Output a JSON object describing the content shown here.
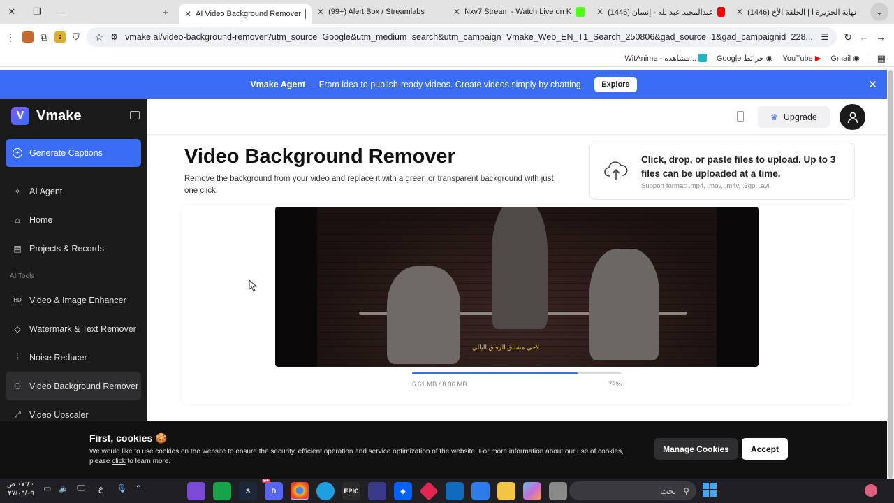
{
  "browser": {
    "tabs": [
      {
        "label": "AI Video Background Remover",
        "active": true,
        "favicon_color": "#5b3fe0"
      },
      {
        "label": "(99+) Alert Box / Streamlabs",
        "active": false,
        "favicon_color": "#16c79a"
      },
      {
        "label": "Nxv7 Stream - Watch Live on K",
        "active": false,
        "favicon_color": "#53fc18"
      },
      {
        "label": "(1446) عبدالمجيد عبدالله - إنسان",
        "active": false,
        "favicon_color": "#ff0000"
      },
      {
        "label": "(1446) نهاية الجزيرة ا | الحلقة الأخ",
        "active": false,
        "favicon_color": "#ff0000"
      }
    ],
    "url": "vmake.ai/video-background-remover?utm_source=Google&utm_medium=search&utm_campaign=Vmake_Web_EN_T1_Search_250806&gad_source=1&gad_campaignid=228...",
    "extension_badge": "2",
    "bookmarks": [
      "WitAnime - مشاهدة...",
      "Google خرائط",
      "YouTube",
      "Gmail"
    ]
  },
  "banner": {
    "brand": "Vmake Agent",
    "text": " — From idea to publish-ready videos. Create videos simply by chatting.",
    "explore_label": "Explore"
  },
  "sidebar": {
    "logo_letter": "V",
    "app_name": "Vmake",
    "primary_button": "Generate Captions",
    "items": [
      {
        "label": "AI Agent",
        "icon": "sparkle-icon"
      },
      {
        "label": "Home",
        "icon": "home-icon"
      },
      {
        "label": "Projects & Records",
        "icon": "document-icon"
      }
    ],
    "section_label": "AI Tools",
    "tools": [
      {
        "label": "Video & Image Enhancer",
        "icon": "hd-icon"
      },
      {
        "label": "Watermark & Text Remover",
        "icon": "eraser-icon"
      },
      {
        "label": "Noise Reducer",
        "icon": "waveform-icon"
      },
      {
        "label": "Video Background Remover",
        "icon": "person-cutout-icon",
        "active": true
      },
      {
        "label": "Video Upscaler",
        "icon": "upscale-icon"
      }
    ]
  },
  "header": {
    "upgrade_label": "Upgrade"
  },
  "page": {
    "title": "Video Background Remover",
    "subtitle": "Remove the background from your video and replace it with a green or transparent background with just one click.",
    "upload_title": "Click, drop, or paste files to upload. Up to 3 files can be uploaded at a time.",
    "upload_formats": "Support format: .mp4, .mov, .m4v, .3gp, .avi"
  },
  "video": {
    "subtitle_text": "لاحي مشتاق الرفاق اليالي",
    "progress_text": "6.61 MB / 8.36 MB",
    "progress_percent_label": "79%",
    "progress_fraction": 0.79
  },
  "cookies": {
    "title": "First, cookies 🍪",
    "text_before": "We would like to use cookies on the website to ensure the security, efficient operation and service optimization of the website. For more information about our use of cookies, please ",
    "link": "click",
    "text_after": " to learn more.",
    "manage_label": "Manage Cookies",
    "accept_label": "Accept"
  },
  "taskbar": {
    "time": "٠٧:٤٠ ص",
    "date": "٢٧/٠٥/٠٩",
    "lang": "ع",
    "search_placeholder": "بحث",
    "discord_badge": "9+"
  },
  "colors": {
    "accent": "#3a6cf4",
    "sidebar_bg": "#1b1b1c",
    "cookie_bg": "#111111"
  }
}
